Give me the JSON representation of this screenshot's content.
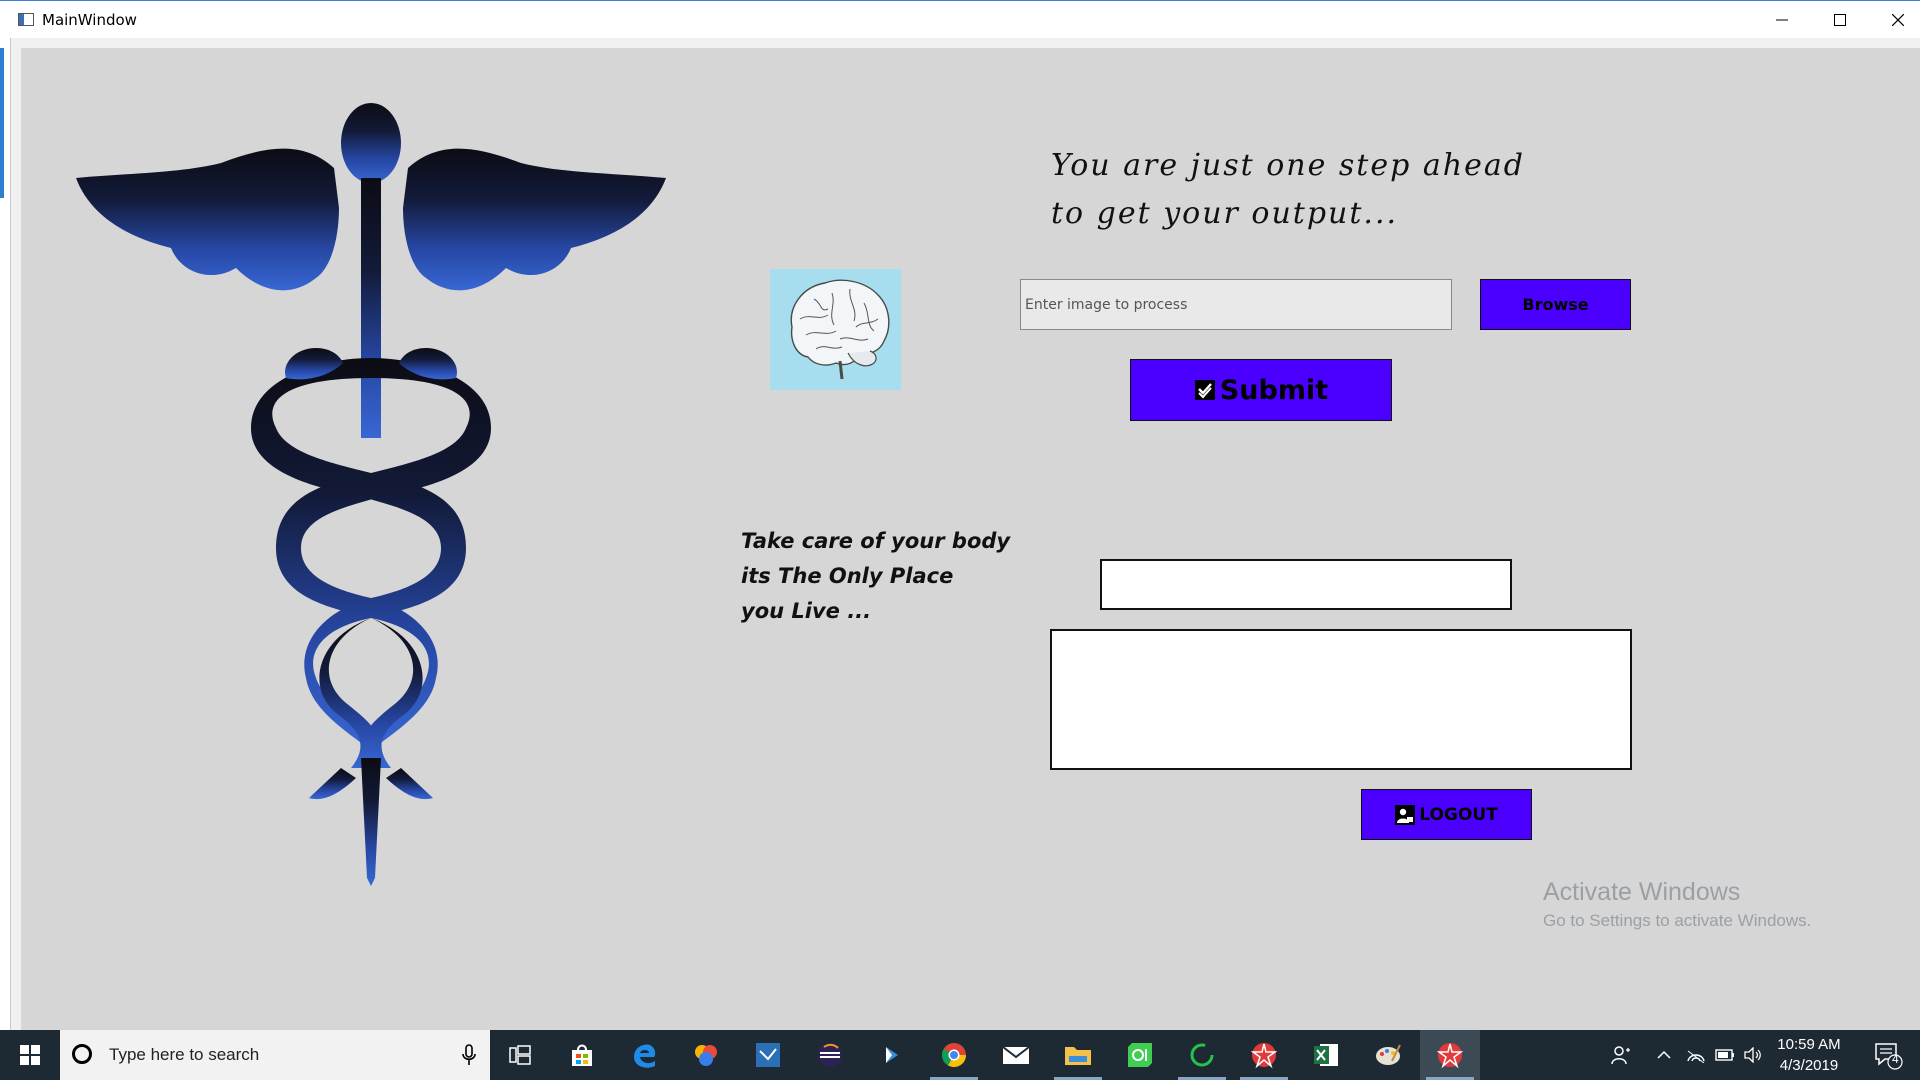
{
  "window": {
    "title": "MainWindow"
  },
  "main": {
    "tagline": [
      "You are just one step ahead",
      "to get your output..."
    ],
    "image_input": {
      "value": "",
      "placeholder": "Enter image to process"
    },
    "browse_label": "Browse",
    "submit_label": "Submit",
    "quote": [
      "Take care of your body",
      "its The Only Place",
      "you Live ..."
    ],
    "result_field": "",
    "result_text": "",
    "logout_label": "LOGOUT",
    "button_color": "#4b00ff",
    "brain_bg_color": "#a6def0"
  },
  "watermark": {
    "title": "Activate Windows",
    "subtitle": "Go to Settings to activate Windows."
  },
  "taskbar": {
    "search_placeholder": "Type here to search",
    "pinned": [
      "task-view-icon",
      "store-icon",
      "edge-icon",
      "photos-icon",
      "visual-studio-icon",
      "eclipse-icon",
      "app-icon",
      "chrome-icon",
      "mail-icon",
      "file-explorer-icon",
      "qt-icon",
      "refresh-app-icon",
      "python-app-icon",
      "excel-icon",
      "paint-icon",
      "python-app-icon-active"
    ],
    "time": "10:59 AM",
    "date": "4/3/2019",
    "notification_count": "4"
  }
}
